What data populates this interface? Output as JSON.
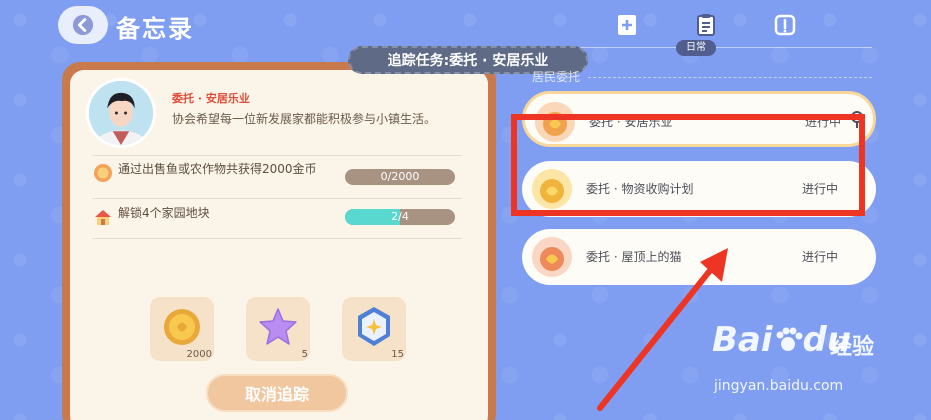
{
  "header": {
    "title": "备忘录",
    "active_tab_label": "日常"
  },
  "tracking": {
    "banner_text": "追踪任务:委托 · 安居乐业"
  },
  "quest_detail": {
    "npc_name": "委托 · 安居乐业",
    "description": "协会希望每一位新发展家都能积极参与小镇生活。",
    "tasks": [
      {
        "text": "通过出售鱼或农作物共获得2000金币",
        "progress_text": "0/2000",
        "progress_fraction": 0.0
      },
      {
        "text": "解锁4个家园地块",
        "progress_text": "2/4",
        "progress_fraction": 0.5
      }
    ],
    "rewards": [
      {
        "icon": "gold-coin-icon",
        "count": "2000"
      },
      {
        "icon": "star-icon",
        "count": "5"
      },
      {
        "icon": "badge-icon",
        "count": "15"
      }
    ],
    "cancel_label": "取消追踪"
  },
  "quest_list": {
    "section_title": "居民委托",
    "items": [
      {
        "name": "委托 · 安居乐业",
        "status": "进行中",
        "selected": true
      },
      {
        "name": "委托 · 物资收购计划",
        "status": "进行中",
        "selected": false
      },
      {
        "name": "委托 · 屋顶上的猫",
        "status": "进行中",
        "selected": false
      }
    ]
  },
  "watermark": {
    "brand": "Bai",
    "brand_suffix": "du",
    "cn": "经验",
    "url": "jingyan.baidu.com"
  },
  "colors": {
    "background": "#7f9ef1",
    "card_border": "#c97a4d",
    "card_bg": "#fbf4e8",
    "highlight_red": "#ee3523",
    "progress_fill": "#58d8cf"
  }
}
